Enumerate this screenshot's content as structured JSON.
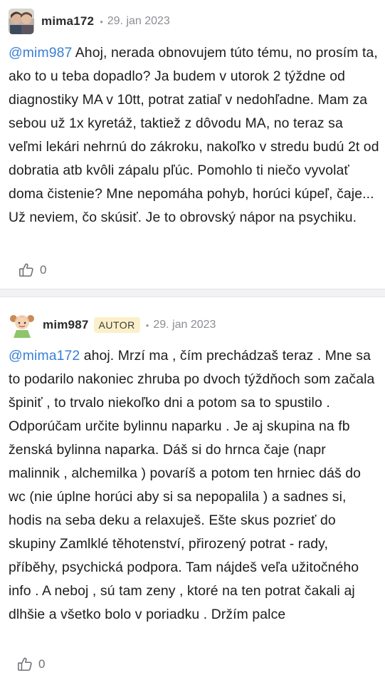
{
  "posts": [
    {
      "username": "mima172",
      "date": "29. jan 2023",
      "mention": "@mim987",
      "text": " Ahoj, nerada obnovujem túto tému, no prosím ta, ako to u teba dopadlo? Ja budem v utorok 2 týždne od diagnostiky MA v 10tt, potrat zatiaľ v nedohľadne. Mam za sebou už 1x kyretáž, taktiež z dôvodu MA, no teraz sa veľmi lekári nehrnú do zákroku, nakoľko v stredu budú 2t od dobratia atb kvôli zápalu pľúc. Pomohlo ti niečo vyvolať doma čistenie? Mne nepomáha pohyb, horúci kúpeľ, čaje... Už neviem, čo skúsiť. Je to obrovský nápor na psychiku.",
      "likes": "0"
    },
    {
      "username": "mim987",
      "badge": "AUTOR",
      "date": "29. jan 2023",
      "mention": "@mima172",
      "text": " ahoj. Mrzí ma , čím prechádzaš teraz . Mne sa to podarilo nakoniec zhruba po dvoch týždňoch som začala špiniť , to trvalo niekoľko dni a potom sa to spustilo . Odporúčam určite bylinnu naparku . Je aj skupina na fb ženská bylinna naparka. Dáš si do hrnca čaje (napr malinnik , alchemilka ) povaríš a potom ten hrniec dáš do wc (nie úplne horúci aby si sa nepopalila ) a sadnes si, hodis na seba deku a relaxuješ. Ešte skus pozrieť do skupiny Zamlklé těhotenství, přirozený potrat - rady, příběhy, psychická podpora. Tam nájdeš veľa užitočného info . A neboj , sú tam zeny , ktoré na ten potrat čakali aj dlhšie a všetko bolo v poriadku . Držím palce",
      "likes": "0"
    }
  ],
  "colors": {
    "mention": "#3a7fd3",
    "badge_bg": "#fbf0c9",
    "divider": "#f2f2f4"
  },
  "icons": {
    "like": "thumbs-up-icon",
    "separator": "dot"
  }
}
